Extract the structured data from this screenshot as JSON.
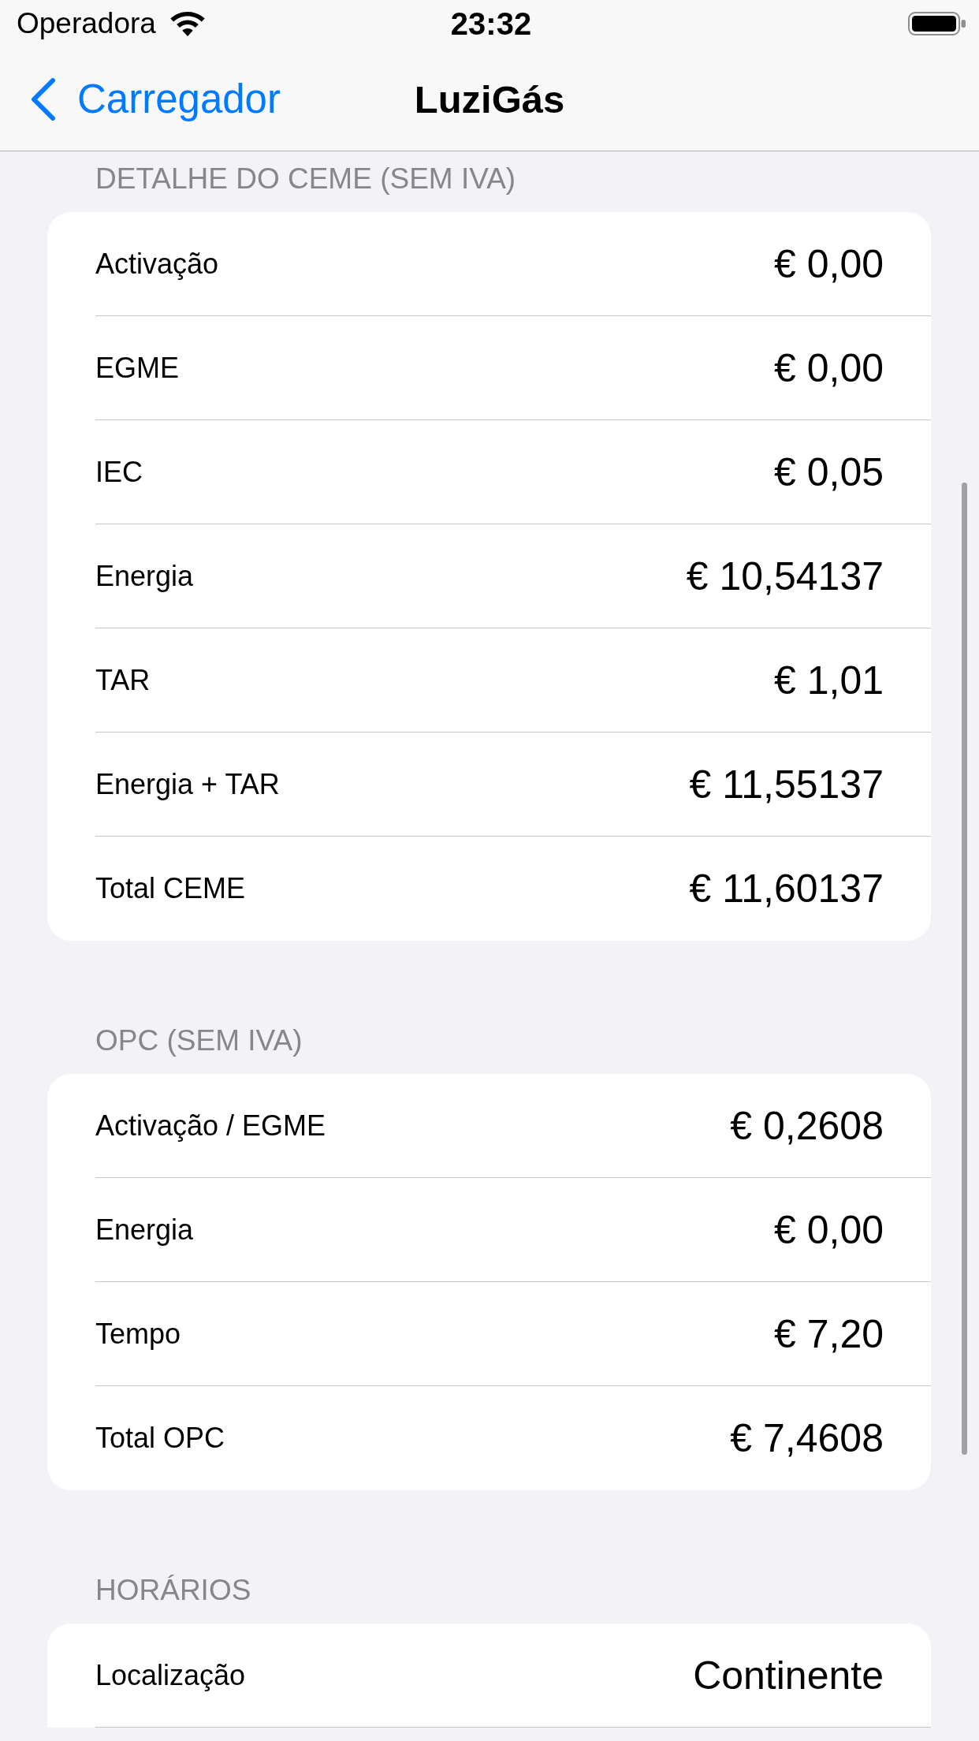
{
  "status_bar": {
    "carrier": "Operadora",
    "time": "23:32"
  },
  "nav_bar": {
    "back_label": "Carregador",
    "title": "LuziGás"
  },
  "sections": [
    {
      "header": "DETALHE DO CEME (SEM IVA)",
      "continues": false,
      "rows": [
        {
          "label": "Activação",
          "value": "€ 0,00"
        },
        {
          "label": "EGME",
          "value": "€ 0,00"
        },
        {
          "label": "IEC",
          "value": "€ 0,05"
        },
        {
          "label": "Energia",
          "value": "€ 10,54137"
        },
        {
          "label": "TAR",
          "value": "€ 1,01"
        },
        {
          "label": "Energia + TAR",
          "value": "€ 11,55137"
        },
        {
          "label": "Total CEME",
          "value": "€ 11,60137"
        }
      ]
    },
    {
      "header": "OPC (SEM IVA)",
      "continues": false,
      "rows": [
        {
          "label": "Activação / EGME",
          "value": "€ 0,2608"
        },
        {
          "label": "Energia",
          "value": "€ 0,00"
        },
        {
          "label": "Tempo",
          "value": "€ 7,20"
        },
        {
          "label": "Total OPC",
          "value": "€ 7,4608"
        }
      ]
    },
    {
      "header": "HORÁRIOS",
      "continues": true,
      "rows": [
        {
          "label": "Localização",
          "value": "Continente"
        }
      ]
    }
  ]
}
